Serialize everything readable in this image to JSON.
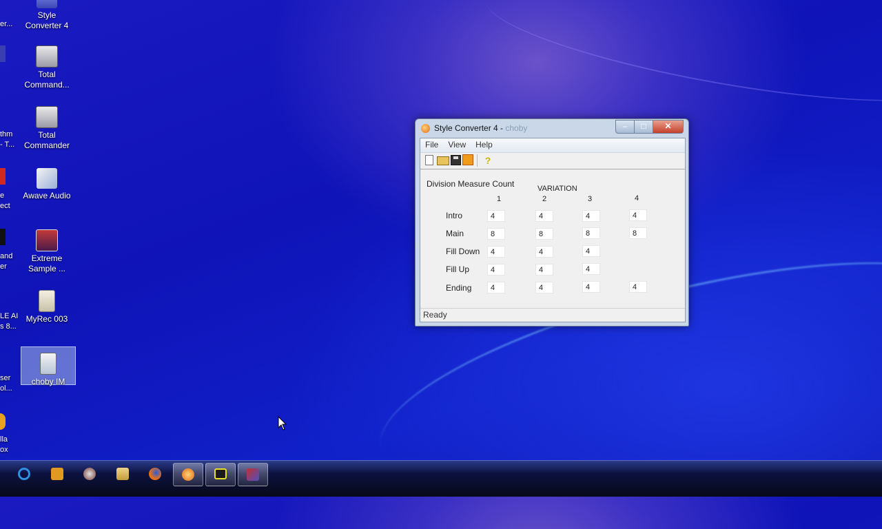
{
  "desktop": {
    "icons": [
      {
        "label_line1": "Style",
        "label_line2": "Converter 4",
        "icon": "style-converter-icon"
      },
      {
        "label_line1": "Total",
        "label_line2": "Command...",
        "icon": "total-commander-icon"
      },
      {
        "label_line1": "Total",
        "label_line2": "Commander",
        "icon": "total-commander-icon"
      },
      {
        "label_line1": "Awave Audio",
        "label_line2": "",
        "icon": "awave-audio-icon"
      },
      {
        "label_line1": "Extreme",
        "label_line2": "Sample ...",
        "icon": "extreme-sample-icon"
      },
      {
        "label_line1": "MyRec 003",
        "label_line2": "",
        "icon": "wav-file-icon"
      },
      {
        "label_line1": "choby IM",
        "label_line2": "",
        "icon": "style-file-icon"
      }
    ],
    "clipped_labels": [
      [
        "er..."
      ],
      [
        "thm",
        "- T..."
      ],
      [
        "e",
        "ect"
      ],
      [
        "and",
        "er"
      ],
      [
        "LE AI",
        "s 8..."
      ],
      [
        "ser",
        "ol..."
      ],
      [
        "lla",
        "ox"
      ]
    ]
  },
  "window": {
    "title_main": "Style Converter 4 - ",
    "title_faded": "choby",
    "buttons": {
      "minimize": "–",
      "maximize": "□",
      "close": "✕"
    },
    "menu": [
      "File",
      "View",
      "Help"
    ],
    "toolbar": [
      "new-icon",
      "open-icon",
      "save-icon",
      "convert-icon",
      "help-icon"
    ],
    "toolbar_help_glyph": "?",
    "panel": {
      "section_title": "Division Measure Count",
      "variation_header": "VARIATION",
      "columns": [
        "1",
        "2",
        "3",
        "4"
      ],
      "rows": [
        {
          "label": "Intro",
          "values": [
            "4",
            "4",
            "4",
            "4"
          ]
        },
        {
          "label": "Main",
          "values": [
            "8",
            "8",
            "8",
            "8"
          ]
        },
        {
          "label": "Fill Down",
          "values": [
            "4",
            "4",
            "4",
            ""
          ]
        },
        {
          "label": "Fill Up",
          "values": [
            "4",
            "4",
            "4",
            ""
          ]
        },
        {
          "label": "Ending",
          "values": [
            "4",
            "4",
            "4",
            "4"
          ]
        }
      ]
    },
    "status": "Ready"
  },
  "taskbar": {
    "items": [
      "ie-icon",
      "media-icon",
      "network-icon",
      "explorer-icon",
      "firefox-icon",
      "style-converter-task-icon",
      "total-commander-task-icon",
      "app-task-icon"
    ]
  },
  "colors": {
    "desktop_blue": "#1418b8",
    "window_frame": "#c9d7e8",
    "close_red": "#c4402a"
  }
}
